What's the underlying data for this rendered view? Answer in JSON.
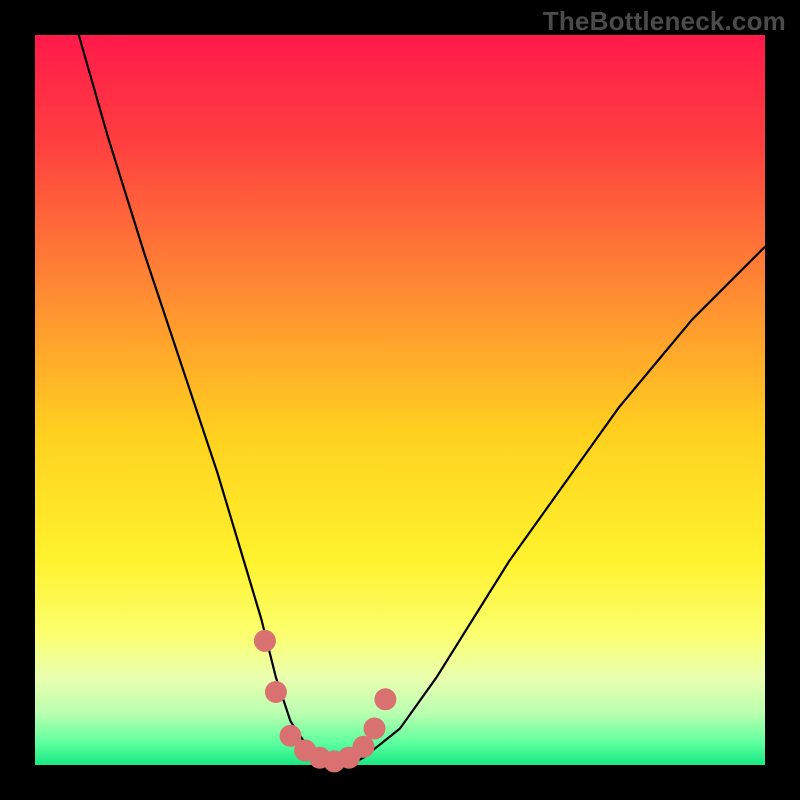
{
  "watermark": "TheBottleneck.com",
  "gradient": {
    "stops": [
      {
        "pct": 0,
        "color": "#ff1a4b"
      },
      {
        "pct": 15,
        "color": "#ff4040"
      },
      {
        "pct": 35,
        "color": "#ff8a33"
      },
      {
        "pct": 55,
        "color": "#ffd21f"
      },
      {
        "pct": 72,
        "color": "#fff22e"
      },
      {
        "pct": 82,
        "color": "#fcff6e"
      },
      {
        "pct": 88,
        "color": "#eaffaf"
      },
      {
        "pct": 93,
        "color": "#b9ffb0"
      },
      {
        "pct": 97,
        "color": "#5cff9e"
      },
      {
        "pct": 100,
        "color": "#17e884"
      }
    ]
  },
  "chart_data": {
    "type": "line",
    "title": "",
    "xlabel": "",
    "ylabel": "",
    "xlim": [
      0,
      100
    ],
    "ylim": [
      0,
      100
    ],
    "grid": false,
    "legend": false,
    "series": [
      {
        "name": "bottleneck-curve",
        "x": [
          6,
          10,
          15,
          20,
          25,
          28,
          31,
          33,
          35,
          37,
          39,
          41,
          43,
          45,
          50,
          55,
          60,
          65,
          70,
          75,
          80,
          85,
          90,
          95,
          100
        ],
        "y": [
          100,
          86,
          70,
          55,
          40,
          30,
          20,
          12,
          6,
          3,
          1,
          0,
          0,
          1,
          5,
          12,
          20,
          28,
          35,
          42,
          49,
          55,
          61,
          66,
          71
        ]
      }
    ],
    "highlight_points": {
      "name": "valley-markers",
      "x": [
        31.5,
        33,
        35,
        37,
        39,
        41,
        43,
        45,
        46.5,
        48
      ],
      "y": [
        17,
        10,
        4,
        2,
        1,
        0.5,
        1,
        2.5,
        5,
        9
      ],
      "color": "#d8716f",
      "radius_px": 11
    }
  }
}
